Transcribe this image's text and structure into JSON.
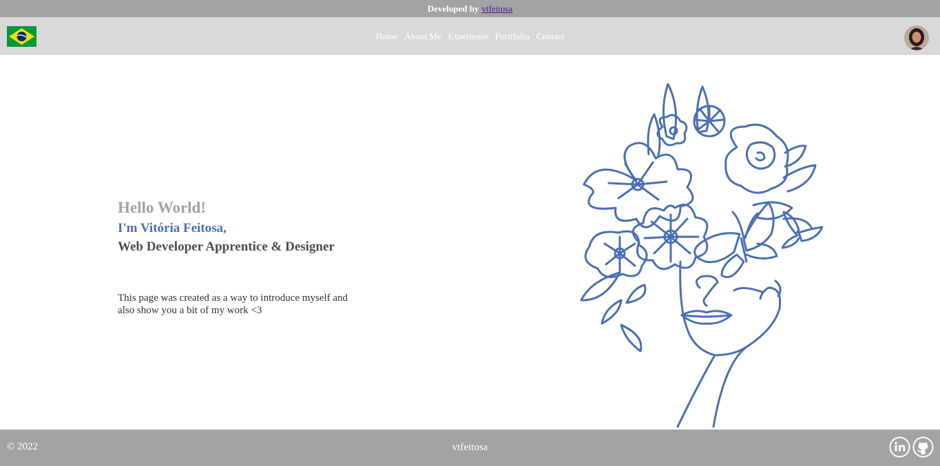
{
  "topbar": {
    "text": "Developed by",
    "link_label": "vtfeitosa"
  },
  "navbar": {
    "flag_icon": "brazil-flag-icon",
    "links": [
      "Home",
      "About Me",
      "Experience",
      "Portifolio",
      "Contact"
    ],
    "avatar_icon": "profile-avatar"
  },
  "intro": {
    "greeting": "Hello World!",
    "name": "I'm Vitória Feitosa,",
    "role": "Web Developer Apprentice & Designer",
    "description": "This page was created as a way to introduce myself and also show you a bit of my work <3"
  },
  "illustration": {
    "icon": "floral-woman-line-art"
  },
  "footer": {
    "copyright": "© 2022",
    "name": "vtfeitosa",
    "social": [
      "linkedin-icon",
      "github-icon"
    ]
  },
  "colors": {
    "bar_gray": "#a3a3a3",
    "nav_gray": "#d9d9d9",
    "accent_blue": "#4a6fb8",
    "role_text": "#4d4d4d"
  }
}
